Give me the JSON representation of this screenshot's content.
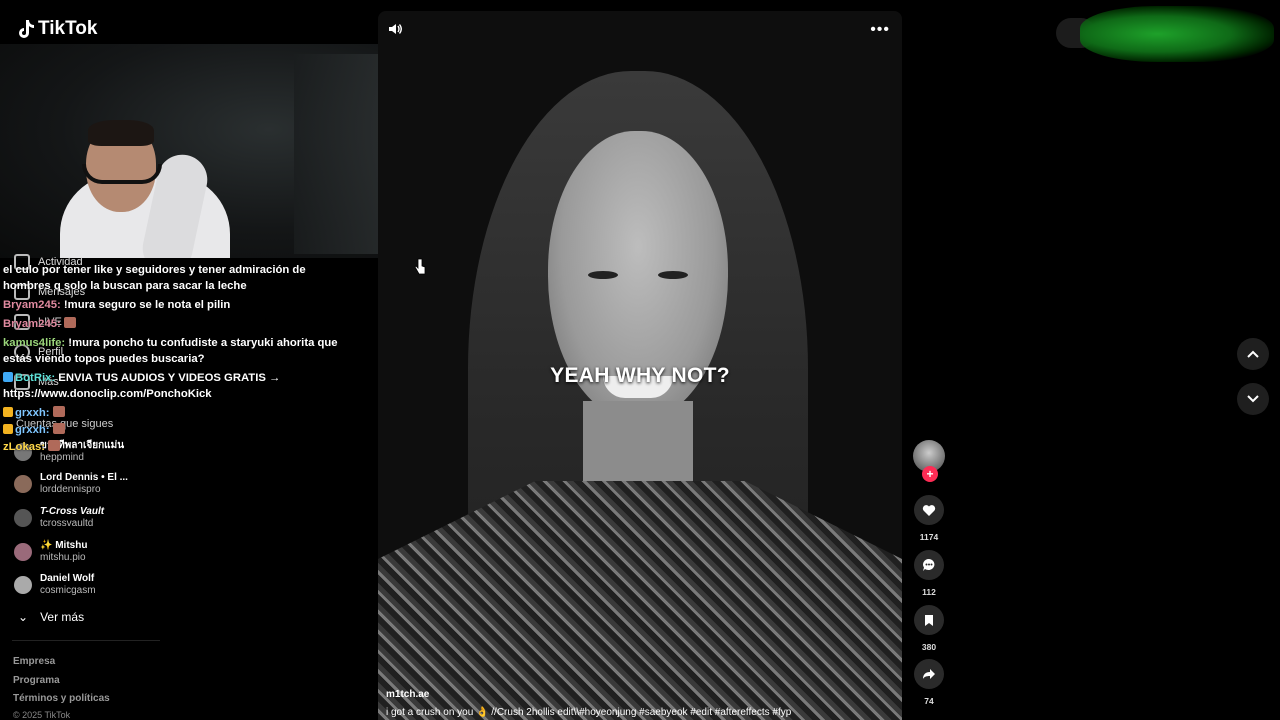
{
  "app": {
    "logo_text": "TikTok"
  },
  "sidebar": {
    "nav_items": [
      {
        "label": "Actividad"
      },
      {
        "label": "Mensajes"
      },
      {
        "label": "LIVE"
      },
      {
        "label": "Perfil"
      },
      {
        "label": "Más"
      }
    ],
    "following_heading": "Cuentas que sigues",
    "accounts": [
      {
        "display": "ขาวทีพลาเจียกแม่น",
        "handle": "heppmind"
      },
      {
        "display": "Lord Dennis • El ...",
        "handle": "lorddennispro"
      },
      {
        "display": "T-Cross Vault",
        "handle": "tcrossvaultd"
      },
      {
        "display": "✨ Mitshu",
        "handle": "mitshu.pio"
      },
      {
        "display": "Daniel Wolf",
        "handle": "cosmicgasm"
      }
    ],
    "see_more": "Ver más",
    "footer": [
      "Empresa",
      "Programa",
      "Términos y políticas"
    ],
    "copyright": "© 2025 TikTok"
  },
  "chat": {
    "line0": "el culo por tener like y seguidores y tener admiración de hombres q solo la buscan para sacar la leche",
    "m1_user": "Bryam245:",
    "m1_text": " !mura seguro se le nota el pilin",
    "m2_user": "Bryam245:",
    "m3_user": "kamus4life:",
    "m3_text": " !mura poncho tu confudiste a staryuki ahorita que estás viendo topos puedes buscaria?",
    "m4_user": "BotRix:",
    "m4_text": " ENVIA TUS AUDIOS Y VIDEOS GRATIS → https://www.donoclip.com/PonchoKick",
    "m5_user": "grxxh:",
    "m6_user": "grxxh:",
    "m7_user": "zLokas:"
  },
  "video": {
    "caption_overlay": "YEAH WHY NOT?",
    "author": "m1tch.ae",
    "description": "i got a crush on you 👌 //Crush 2hollis edit\\\\#hoyeonjung  #saebyeok  #edit  #aftereffects  #fyp",
    "more_label": "•••"
  },
  "actions": {
    "likes": "1174",
    "comments": "112",
    "saves": "380",
    "shares": "74",
    "follow_plus": "+"
  },
  "colors": {
    "accent": "#fe2c55",
    "background": "#000000"
  }
}
